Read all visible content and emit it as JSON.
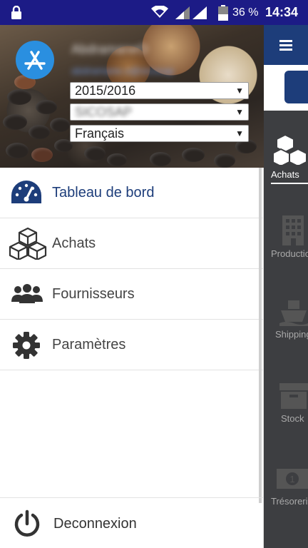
{
  "status_bar": {
    "battery": "36 %",
    "time": "14:34",
    "icons": [
      "lock-icon",
      "wifi-icon",
      "signal-icon",
      "battery-icon"
    ]
  },
  "header": {
    "user_name": "AbdramaneO",
    "user_sub": "abdramane.o@sicosap"
  },
  "selects": {
    "year": "2015/2016",
    "company": "SICOSAP",
    "language": "Français"
  },
  "menu": [
    {
      "label": "Tableau de bord",
      "icon": "dashboard-icon",
      "active": true
    },
    {
      "label": "Achats",
      "icon": "boxes-icon",
      "active": false
    },
    {
      "label": "Fournisseurs",
      "icon": "users-icon",
      "active": false
    },
    {
      "label": "Paramètres",
      "icon": "gear-icon",
      "active": false
    }
  ],
  "logout": {
    "label": "Deconnexion",
    "icon": "power-icon"
  },
  "right_nav": [
    {
      "label": "Achats",
      "icon": "boxes-icon"
    },
    {
      "label": "Production",
      "icon": "building-icon"
    },
    {
      "label": "Shipping",
      "icon": "ship-icon"
    },
    {
      "label": "Stock",
      "icon": "archive-icon"
    },
    {
      "label": "Trésorerie",
      "icon": "money-icon"
    }
  ],
  "colors": {
    "status_bar": "#1c1b86",
    "accent": "#1d3d7a",
    "right_pane": "#3d3e41",
    "logo": "#2a8fe0"
  }
}
